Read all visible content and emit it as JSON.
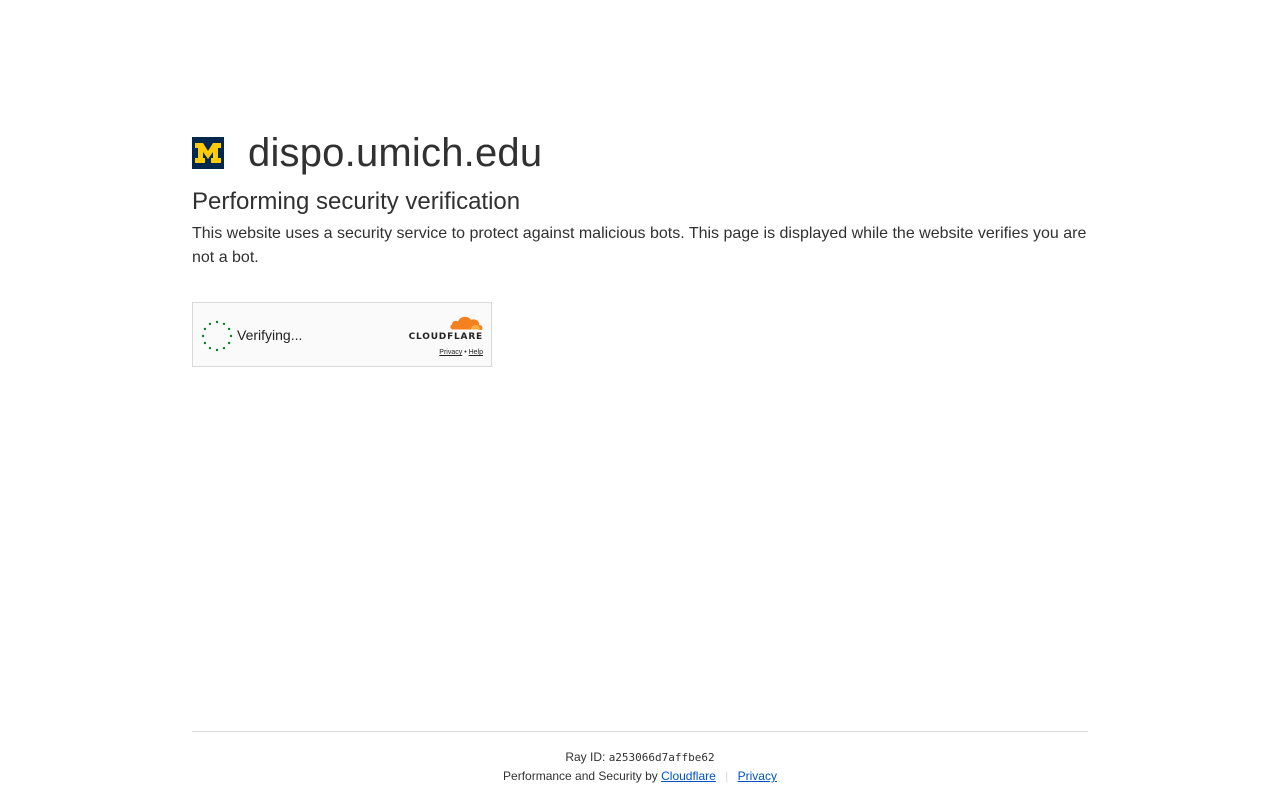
{
  "header": {
    "site_name": "dispo.umich.edu",
    "logo_icon": "umich-block-m-logo",
    "logo_letter": "M",
    "logo_colors": {
      "background": "#00274C",
      "letter": "#FFCB05"
    }
  },
  "main": {
    "heading": "Performing security verification",
    "description": "This website uses a security service to protect against malicious bots. This page is displayed while the website verifies you are not a bot."
  },
  "widget": {
    "status_text": "Verifying...",
    "spinner_icon": "loading-spinner-icon",
    "brand_icon": "cloudflare-cloud-logo",
    "brand_name": "CLOUDFLARE",
    "privacy_label": "Privacy",
    "links_separator": "•",
    "help_label": "Help",
    "colors": {
      "spinner": "#038127",
      "cloud": "#F48120"
    }
  },
  "footer": {
    "ray_label": "Ray ID:",
    "ray_id": "a253066d7affbe62",
    "performance_text": "Performance and Security by",
    "cloudflare_link": "Cloudflare",
    "separator": "|",
    "privacy_link": "Privacy",
    "link_color": "#0051C3"
  }
}
